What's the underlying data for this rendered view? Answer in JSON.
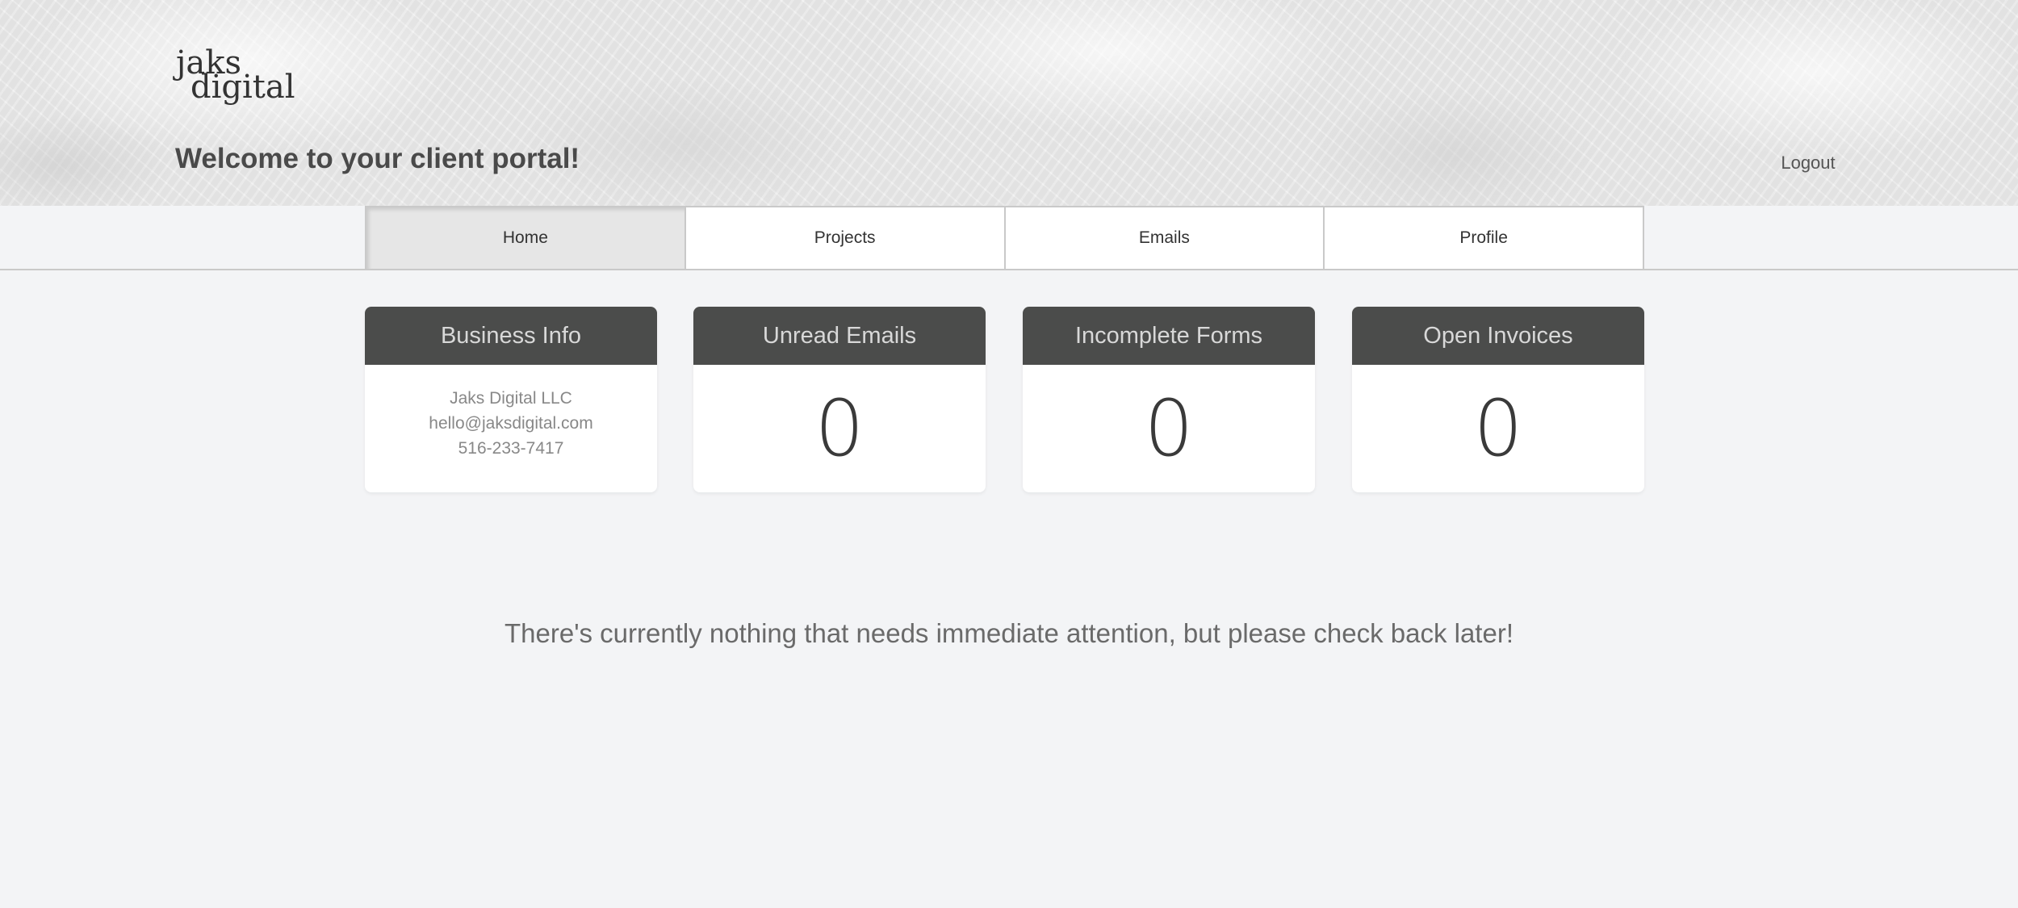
{
  "header": {
    "logo_line1": "jaks",
    "logo_line2": "digital",
    "welcome": "Welcome to your client portal!",
    "logout_label": "Logout"
  },
  "tabs": [
    {
      "label": "Home",
      "active": true
    },
    {
      "label": "Projects",
      "active": false
    },
    {
      "label": "Emails",
      "active": false
    },
    {
      "label": "Profile",
      "active": false
    }
  ],
  "cards": {
    "business_info": {
      "title": "Business Info",
      "company": "Jaks Digital LLC",
      "email": "hello@jaksdigital.com",
      "phone": "516-233-7417"
    },
    "unread_emails": {
      "title": "Unread Emails",
      "count": "0"
    },
    "incomplete_forms": {
      "title": "Incomplete Forms",
      "count": "0"
    },
    "open_invoices": {
      "title": "Open Invoices",
      "count": "0"
    }
  },
  "notice": "There's currently nothing that needs immediate attention, but please check back later!",
  "colors": {
    "card_header_bg": "#4b4c4b",
    "page_bg": "#f3f4f6",
    "active_tab_bg": "#e6e6e6"
  }
}
